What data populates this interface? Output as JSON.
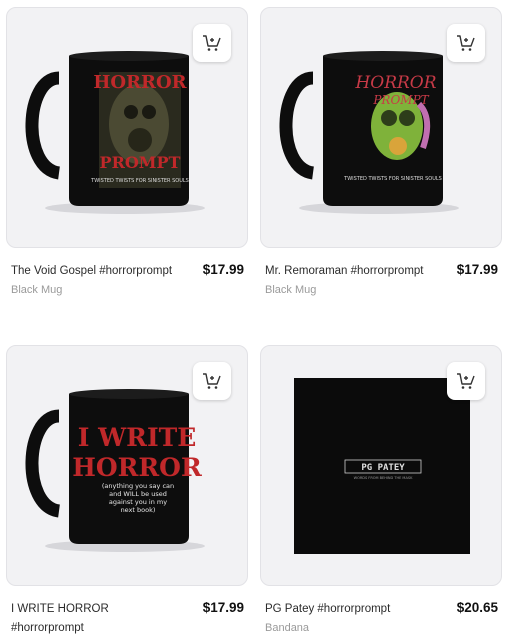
{
  "products": [
    {
      "title": "The Void Gospel #horrorprompt",
      "price": "$17.99",
      "type": "Black Mug",
      "art": {
        "line1": "HORROR",
        "line2": "PROMPT",
        "tagline": "TWISTED TWISTS FOR SINISTER SOULS"
      }
    },
    {
      "title": "Mr. Remoraman #horrorprompt",
      "price": "$17.99",
      "type": "Black Mug",
      "art": {
        "line1": "HORROR",
        "line2": "PROMPT",
        "tagline": "TWISTED TWISTS FOR SINISTER SOULS"
      }
    },
    {
      "title": "I WRITE HORROR #horrorprompt",
      "price": "$17.99",
      "type": "",
      "art": {
        "line1": "I WRITE",
        "line2": "HORROR",
        "tagline": "(anything you say can and WILL be used against you in my next book)"
      }
    },
    {
      "title": "PG Patey #horrorprompt",
      "price": "$20.65",
      "type": "Bandana",
      "art": {
        "line1": "PG PATEY",
        "tagline": "WORDS FROM BEHIND THE MASK"
      }
    }
  ],
  "icons": {
    "cart": "add-to-cart-icon"
  },
  "colors": {
    "mug": "#0d0d0d",
    "horror_red": "#c0282a",
    "card_bg": "#f2f2f4"
  }
}
